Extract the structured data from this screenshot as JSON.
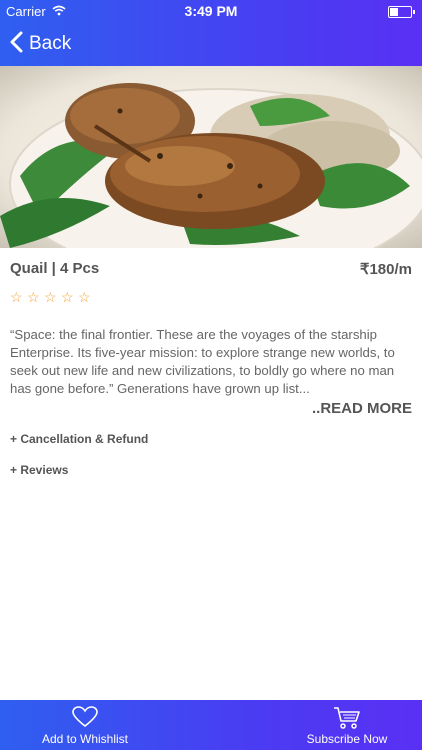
{
  "status_bar": {
    "carrier": "Carrier",
    "time": "3:49 PM"
  },
  "nav": {
    "back_label": "Back"
  },
  "product": {
    "title": "Quail | 4 Pcs",
    "price": "₹180/m",
    "rating": 0,
    "rating_max": 5,
    "description": "“Space: the final frontier. These are the voyages of the starship Enterprise. Its five-year mission: to explore strange new worlds, to seek out new life and new civilizations, to boldly go where no man has gone before.” Generations have grown up list...",
    "read_more_label": "..READ MORE"
  },
  "sections": {
    "cancellation_label": "+ Cancellation & Refund",
    "reviews_label": "+ Reviews"
  },
  "bottom_bar": {
    "wishlist_label": "Add to Whishlist",
    "subscribe_label": "Subscribe Now"
  },
  "colors": {
    "accent": "#3d4ef3",
    "star": "#f2a33a"
  },
  "icons": [
    "wifi-icon",
    "battery-icon",
    "chevron-left-icon",
    "star-outline-icon",
    "heart-icon",
    "cart-icon"
  ]
}
